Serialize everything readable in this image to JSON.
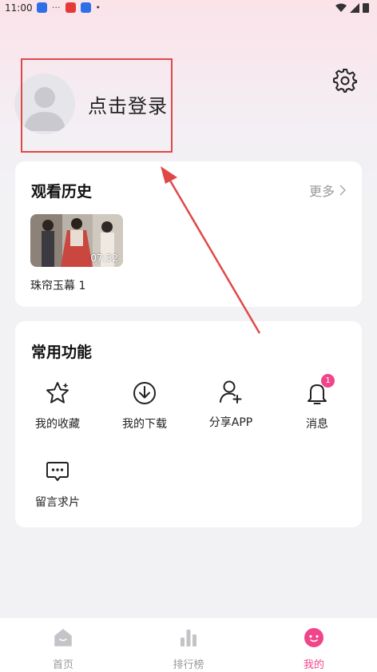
{
  "status_bar": {
    "time": "11:00",
    "dots": "···"
  },
  "profile": {
    "login_text": "点击登录"
  },
  "history": {
    "title": "观看历史",
    "more_label": "更多",
    "items": [
      {
        "title": "珠帘玉幕 1",
        "duration": "07:32"
      }
    ]
  },
  "features": {
    "title": "常用功能",
    "items": [
      {
        "label": "我的收藏",
        "icon": "star-icon"
      },
      {
        "label": "我的下载",
        "icon": "download-icon"
      },
      {
        "label": "分享APP",
        "icon": "add-user-icon"
      },
      {
        "label": "消息",
        "icon": "bell-icon",
        "badge": "1"
      },
      {
        "label": "留言求片",
        "icon": "message-icon"
      }
    ]
  },
  "tabbar": {
    "items": [
      {
        "label": "首页",
        "icon": "home-icon"
      },
      {
        "label": "排行榜",
        "icon": "ranking-icon"
      },
      {
        "label": "我的",
        "icon": "profile-icon",
        "active": true
      }
    ]
  },
  "colors": {
    "accent": "#f0458a",
    "annotation": "#e04848"
  }
}
